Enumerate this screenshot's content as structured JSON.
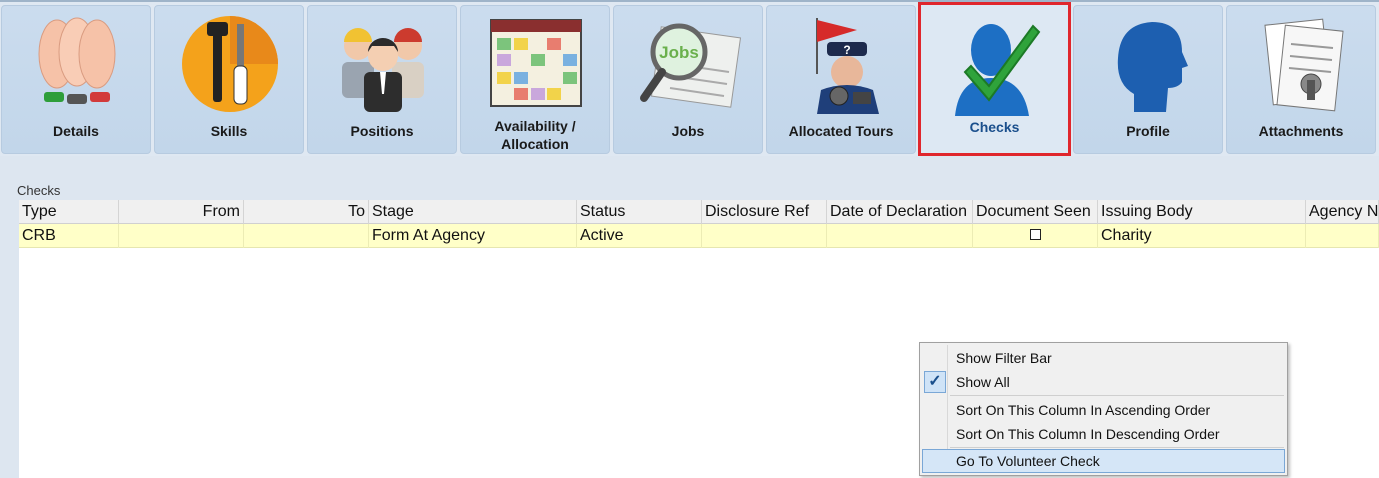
{
  "tabs": [
    {
      "id": "details",
      "label": "Details",
      "icon": "hands-icon"
    },
    {
      "id": "skills",
      "label": "Skills",
      "icon": "tools-icon"
    },
    {
      "id": "positions",
      "label": "Positions",
      "icon": "workers-icon"
    },
    {
      "id": "availability",
      "label_line1": "Availability /",
      "label_line2": "Allocation",
      "icon": "calendar-icon"
    },
    {
      "id": "jobs",
      "label": "Jobs",
      "icon": "magnifier-jobs-icon"
    },
    {
      "id": "allocated-tours",
      "label": "Allocated Tours",
      "icon": "tour-guide-icon"
    },
    {
      "id": "checks",
      "label": "Checks",
      "icon": "person-check-icon",
      "active": true
    },
    {
      "id": "profile",
      "label": "Profile",
      "icon": "profile-head-icon"
    },
    {
      "id": "attachments",
      "label": "Attachments",
      "icon": "documents-icon"
    }
  ],
  "checks": {
    "section_title": "Checks",
    "columns": [
      "Type",
      "From",
      "To",
      "Stage",
      "Status",
      "Disclosure Ref",
      "Date of Declaration",
      "Document Seen",
      "Issuing Body",
      "Agency N"
    ],
    "rows": [
      {
        "type": "CRB",
        "from": "",
        "to": "",
        "stage": "Form At Agency",
        "status": "Active",
        "disclosure_ref": "",
        "date_of_declaration": "",
        "document_seen": false,
        "issuing_body": "Charity",
        "agency": ""
      }
    ]
  },
  "context_menu": {
    "items": [
      {
        "label": "Show Filter Bar",
        "checked": false
      },
      {
        "label": "Show All",
        "checked": true
      },
      {
        "label": "Sort On This Column In Ascending Order",
        "checked": false
      },
      {
        "label": "Sort On This Column In Descending Order",
        "checked": false
      },
      {
        "label": "Go To Volunteer Check",
        "checked": false,
        "highlighted": true
      }
    ]
  },
  "colors": {
    "active_tab_border": "#e0262c",
    "row_highlight": "#ffffc8",
    "accent": "#1a4f8c"
  }
}
